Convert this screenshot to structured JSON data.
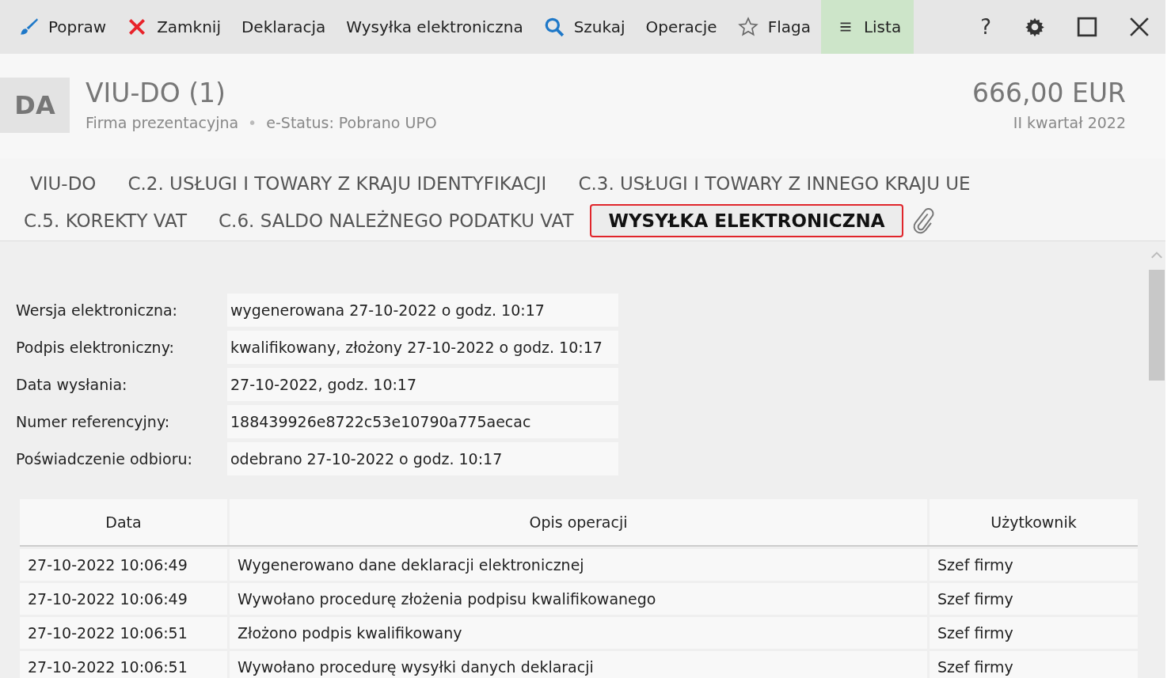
{
  "toolbar": {
    "items": [
      {
        "label": "Popraw",
        "selected": false
      },
      {
        "label": "Zamknij",
        "selected": false
      },
      {
        "label": "Deklaracja",
        "selected": false
      },
      {
        "label": "Wysyłka elektroniczna",
        "selected": false
      },
      {
        "label": "Szukaj",
        "selected": false
      },
      {
        "label": "Operacje",
        "selected": false
      },
      {
        "label": "Flaga",
        "selected": false
      },
      {
        "label": "Lista",
        "selected": true
      }
    ],
    "help": "?"
  },
  "header": {
    "badge": "DA",
    "title": "VIU-DO (1)",
    "company": "Firma prezentacyjna",
    "separator": "•",
    "status": "e-Status: Pobrano UPO",
    "amount": "666,00 EUR",
    "period": "II kwartał 2022"
  },
  "tabs": [
    {
      "label": "VIU-DO",
      "selected": false
    },
    {
      "label": "C.2. USŁUGI I TOWARY Z KRAJU IDENTYFIKACJI",
      "selected": false
    },
    {
      "label": "C.3. USŁUGI I TOWARY Z INNEGO KRAJU UE",
      "selected": false
    },
    {
      "label": "C.5. KOREKTY VAT",
      "selected": false
    },
    {
      "label": "C.6. SALDO NALEŻNEGO PODATKU VAT",
      "selected": false
    },
    {
      "label": "WYSYŁKA ELEKTRONICZNA",
      "selected": true
    }
  ],
  "fields": [
    {
      "label": "Wersja elektroniczna:",
      "value": "wygenerowana 27-10-2022 o godz. 10:17"
    },
    {
      "label": "Podpis elektroniczny:",
      "value": "kwalifikowany, złożony 27-10-2022 o godz. 10:17"
    },
    {
      "label": "Data wysłania:",
      "value": "27-10-2022, godz. 10:17"
    },
    {
      "label": "Numer referencyjny:",
      "value": "188439926e8722c53e10790a775aecac"
    },
    {
      "label": "Poświadczenie odbioru:",
      "value": "odebrano 27-10-2022 o godz. 10:17"
    }
  ],
  "table": {
    "columns": [
      "Data",
      "Opis operacji",
      "Użytkownik"
    ],
    "rows": [
      [
        "27-10-2022 10:06:49",
        "Wygenerowano dane deklaracji elektronicznej",
        "Szef firmy"
      ],
      [
        "27-10-2022 10:06:49",
        "Wywołano procedurę złożenia podpisu kwalifikowanego",
        "Szef firmy"
      ],
      [
        "27-10-2022 10:06:51",
        "Złożono podpis kwalifikowany",
        "Szef firmy"
      ],
      [
        "27-10-2022 10:06:51",
        "Wywołano procedurę wysyłki danych deklaracji",
        "Szef firmy"
      ]
    ]
  }
}
